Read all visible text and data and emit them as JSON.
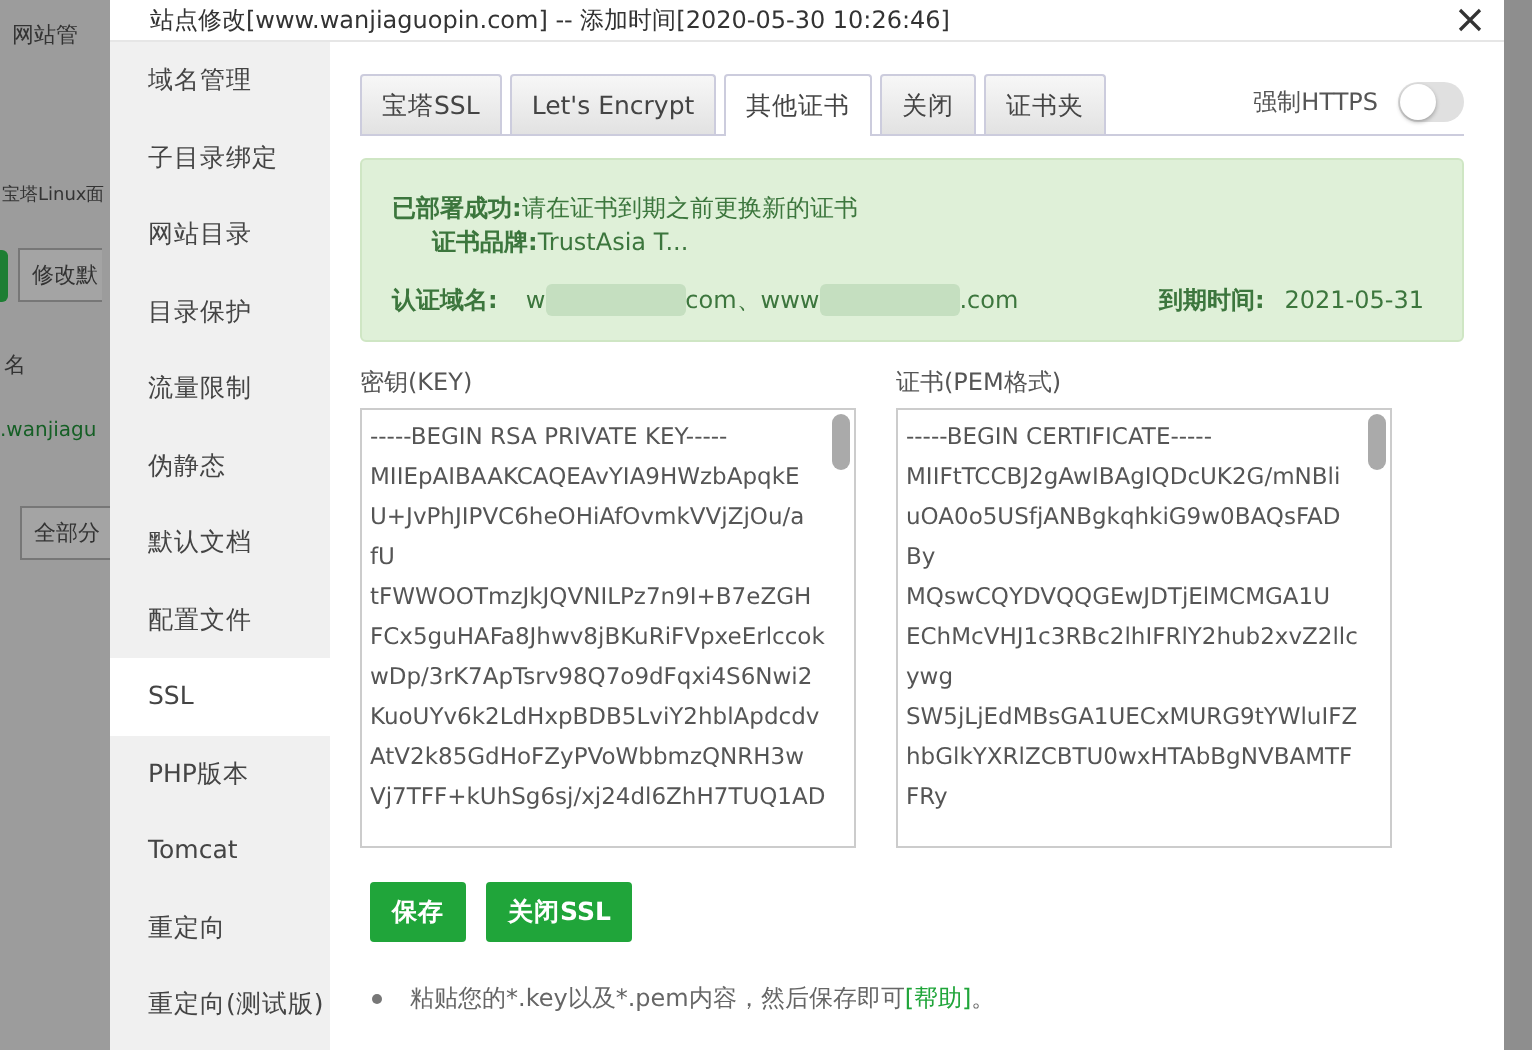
{
  "background": {
    "heading": "网站管",
    "panel_title": "宝塔Linux面",
    "button_partial": "修改默",
    "column_header": "名",
    "site_link": ".wanjiagu",
    "button_partial_2": "全部分"
  },
  "modal": {
    "title": "站点修改[www.wanjiaguopin.com] -- 添加时间[2020-05-30 10:26:46]"
  },
  "sidebar": {
    "items": [
      {
        "label": "域名管理",
        "selected": false
      },
      {
        "label": "子目录绑定",
        "selected": false
      },
      {
        "label": "网站目录",
        "selected": false
      },
      {
        "label": "目录保护",
        "selected": false
      },
      {
        "label": "流量限制",
        "selected": false
      },
      {
        "label": "伪静态",
        "selected": false
      },
      {
        "label": "默认文档",
        "selected": false
      },
      {
        "label": "配置文件",
        "selected": false
      },
      {
        "label": "SSL",
        "selected": true
      },
      {
        "label": "PHP版本",
        "selected": false
      },
      {
        "label": "Tomcat",
        "selected": false
      },
      {
        "label": "重定向",
        "selected": false
      },
      {
        "label": "重定向(测试版)",
        "selected": false
      }
    ]
  },
  "tabs": [
    {
      "label": "宝塔SSL",
      "selected": false
    },
    {
      "label": "Let's Encrypt",
      "selected": false
    },
    {
      "label": "其他证书",
      "selected": true
    },
    {
      "label": "关闭",
      "selected": false
    },
    {
      "label": "证书夹",
      "selected": false
    }
  ],
  "force_https": {
    "label": "强制HTTPS",
    "on": false
  },
  "status": {
    "deployed_label": "已部署成功:",
    "deployed_text": "请在证书到期之前更换新的证书",
    "brand_label": "证书品牌:",
    "brand_value": "TrustAsia T...",
    "domain_label": "认证域名:",
    "domain_parts": [
      "w",
      "com、www",
      ".com"
    ],
    "expiry_label": "到期时间:",
    "expiry_value": "2021-05-31"
  },
  "key": {
    "label": "密钥(KEY)",
    "lines": [
      "-----BEGIN RSA PRIVATE KEY-----",
      "MIIEpAIBAAKCAQEAvYIA9HWzbApqkE",
      "U+JvPhJIPVC6heOHiAfOvmkVVjZjOu/a",
      "fU",
      "tFWWOOTmzJkJQVNILPz7n9I+B7eZGH",
      "FCx5guHAFa8Jhwv8jBKuRiFVpxeErlccok",
      "wDp/3rK7ApTsrv98Q7o9dFqxi4S6Nwi2",
      "KuoUYv6k2LdHxpBDB5LviY2hblApdcdv",
      "AtV2k85GdHoFZyPVoWbbmzQNRH3w",
      "Vj7TFF+kUhSg6sj/xj24dl6ZhH7TUQ1AD"
    ]
  },
  "cert": {
    "label": "证书(PEM格式)",
    "lines": [
      "-----BEGIN CERTIFICATE-----",
      "MIIFtTCCBJ2gAwIBAgIQDcUK2G/mNBli",
      "uOA0o5USfjANBgkqhkiG9w0BAQsFAD",
      "By",
      "MQswCQYDVQQGEwJDTjElMCMGA1U",
      "EChMcVHJ1c3RBc2lhIFRlY2hub2xvZ2llc",
      "ywg",
      "SW5jLjEdMBsGA1UECxMURG9tYWluIFZ",
      "hbGlkYXRlZCBTU0wxHTAbBgNVBAMTF",
      "FRy"
    ]
  },
  "buttons": [
    {
      "label": "保存"
    },
    {
      "label": "关闭SSL"
    }
  ],
  "notes": [
    {
      "before": "粘贴您的*.key以及*.pem内容，然后保存即可",
      "link": "[帮助]",
      "after": "。"
    }
  ]
}
